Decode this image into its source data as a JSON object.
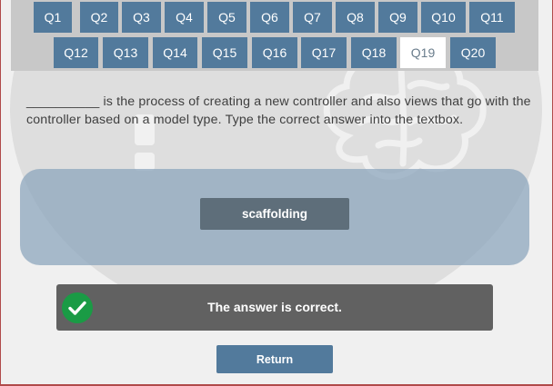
{
  "nav": {
    "questions": [
      "Q1",
      "Q2",
      "Q3",
      "Q4",
      "Q5",
      "Q6",
      "Q7",
      "Q8",
      "Q9",
      "Q10",
      "Q11",
      "Q12",
      "Q13",
      "Q14",
      "Q15",
      "Q16",
      "Q17",
      "Q18",
      "Q19",
      "Q20"
    ],
    "current": "Q19"
  },
  "question": {
    "text": "__________ is the process of creating a new controller and also views that go with the controller based on a model type. Type the correct answer into the textbox."
  },
  "answer": {
    "value": "scaffolding"
  },
  "result": {
    "text": "The answer is correct.",
    "status_icon": "check-circle-icon",
    "status_color": "#1a9b45"
  },
  "return_label": "Return",
  "colors": {
    "accent": "#527a9c",
    "banner": "#616161",
    "border": "#b04a4a"
  }
}
